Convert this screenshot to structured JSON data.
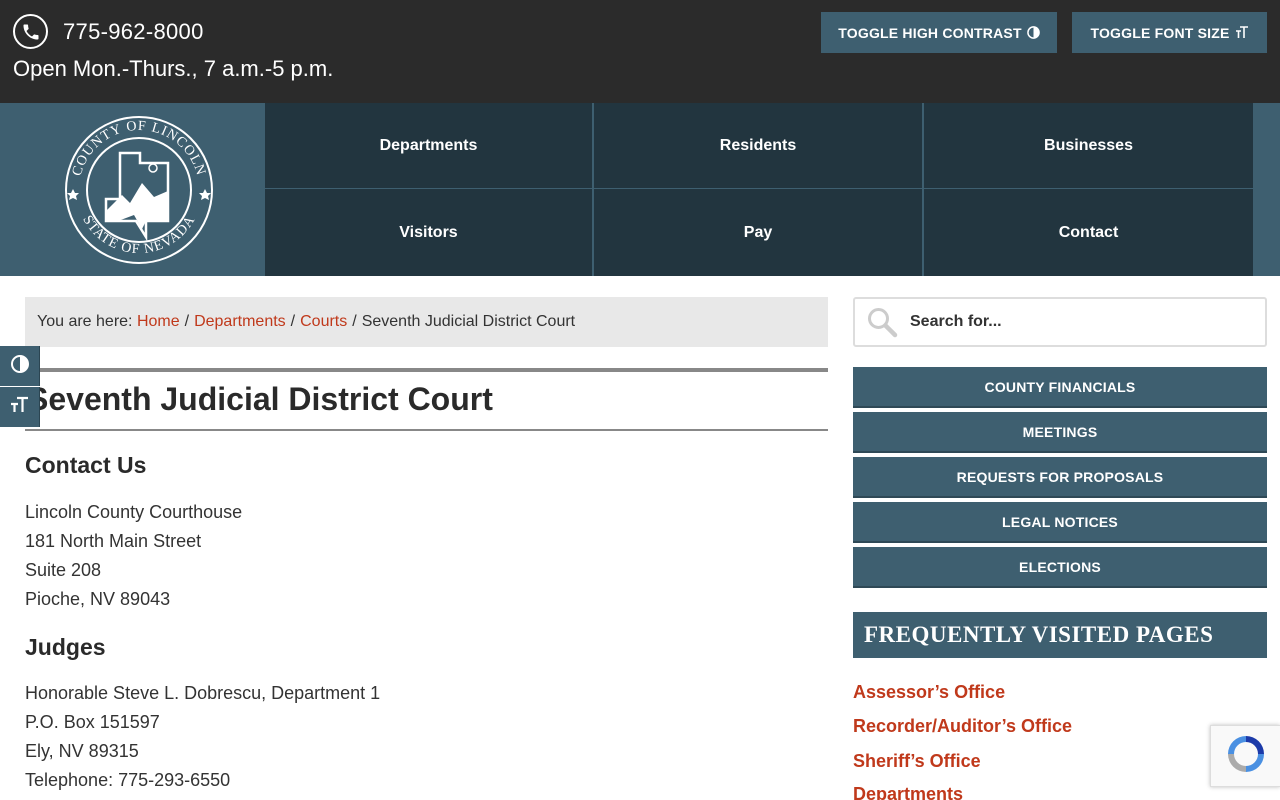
{
  "topbar": {
    "phone": "775-962-8000",
    "hours": "Open Mon.-Thurs., 7 a.m.-5 p.m.",
    "contrast_label": "TOGGLE HIGH CONTRAST",
    "fontsize_label": "TOGGLE FONT SIZE"
  },
  "logo": {
    "top_text": "COUNTY OF LINCOLN",
    "bottom_text": "STATE OF NEVADA"
  },
  "nav": {
    "items": [
      {
        "label": "Departments"
      },
      {
        "label": "Residents"
      },
      {
        "label": "Businesses"
      },
      {
        "label": "Visitors"
      },
      {
        "label": "Pay"
      },
      {
        "label": "Contact"
      }
    ]
  },
  "breadcrumb": {
    "prefix": "You are here:",
    "links": [
      "Home",
      "Departments",
      "Courts"
    ],
    "current": "Seventh Judicial District Court",
    "separator": "/"
  },
  "main": {
    "title": "Seventh Judicial District Court",
    "contact_heading": "Contact Us",
    "address": [
      "Lincoln County Courthouse",
      "181 North Main Street",
      "Suite 208",
      "Pioche, NV 89043"
    ],
    "judges_heading": "Judges",
    "judge": [
      "Honorable Steve L. Dobrescu, Department 1",
      "P.O. Box 151597",
      "Ely, NV 89315",
      "Telephone: 775-293-6550"
    ]
  },
  "sidebar": {
    "search_placeholder": "Search for...",
    "buttons": [
      "COUNTY FINANCIALS",
      "MEETINGS",
      "REQUESTS FOR PROPOSALS",
      "LEGAL NOTICES",
      "ELECTIONS"
    ],
    "fvp_heading": "FREQUENTLY VISITED PAGES",
    "links": [
      "Assessor’s Office",
      "Recorder/Auditor’s Office",
      "Sheriff’s Office",
      "Departments"
    ]
  },
  "colors": {
    "accent": "#3e5f70",
    "nav_bg": "#22353f",
    "topbar_bg": "#2b2b2b",
    "link": "#c0391b"
  },
  "icons": [
    "phone-icon",
    "contrast-icon",
    "font-size-icon",
    "search-icon",
    "recaptcha-icon"
  ]
}
